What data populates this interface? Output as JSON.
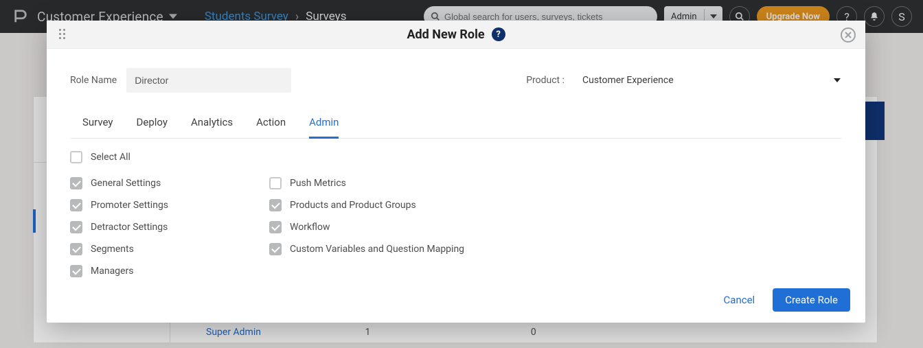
{
  "topbar": {
    "workspace": "Customer Experience",
    "breadcrumb_link": "Students Survey",
    "breadcrumb_current": "Surveys",
    "search_placeholder": "Global search for users, surveys, tickets",
    "admin_label": "Admin",
    "upgrade_label": "Upgrade Now",
    "avatar_initial": "S"
  },
  "background": {
    "row_link": "Super Admin",
    "row_col1": "1",
    "row_col2": "0"
  },
  "modal": {
    "title": "Add New Role",
    "role_name_label": "Role Name",
    "role_name_value": "Director",
    "product_label": "Product :",
    "product_value": "Customer Experience",
    "tabs": {
      "survey": "Survey",
      "deploy": "Deploy",
      "analytics": "Analytics",
      "action": "Action",
      "admin": "Admin"
    },
    "checks": {
      "select_all": "Select All",
      "general_settings": "General Settings",
      "promoter_settings": "Promoter Settings",
      "detractor_settings": "Detractor Settings",
      "segments": "Segments",
      "managers": "Managers",
      "push_metrics": "Push Metrics",
      "products_groups": "Products and Product Groups",
      "workflow": "Workflow",
      "custom_vars": "Custom Variables and Question Mapping"
    },
    "footer": {
      "cancel": "Cancel",
      "create": "Create Role"
    }
  }
}
